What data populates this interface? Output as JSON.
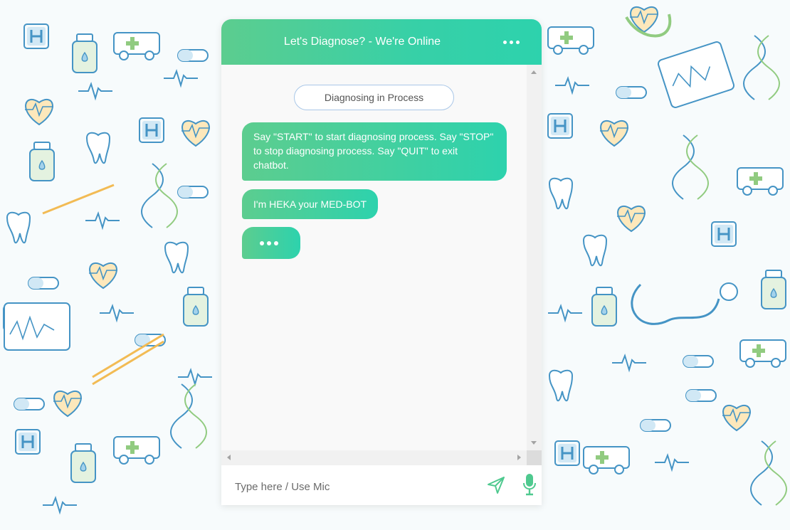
{
  "header": {
    "title": "Let's Diagnose? - We're Online",
    "menu_icon": "more-horizontal-icon"
  },
  "status": {
    "label": "Diagnosing in Process"
  },
  "messages": [
    {
      "text": "Say \"START\" to start diagnosing process. Say \"STOP\" to stop diagnosing process. Say \"QUIT\" to exit chatbot."
    },
    {
      "text": "I'm HEKA your MED-BOT"
    },
    {
      "typing": true
    }
  ],
  "input": {
    "placeholder": "Type here / Use Mic",
    "value": ""
  },
  "icons": {
    "send": "send-icon",
    "mic": "mic-icon"
  },
  "colors": {
    "accent_start": "#5ccd8f",
    "accent_end": "#2dd2ad",
    "pill_border": "#a9c7e8"
  }
}
